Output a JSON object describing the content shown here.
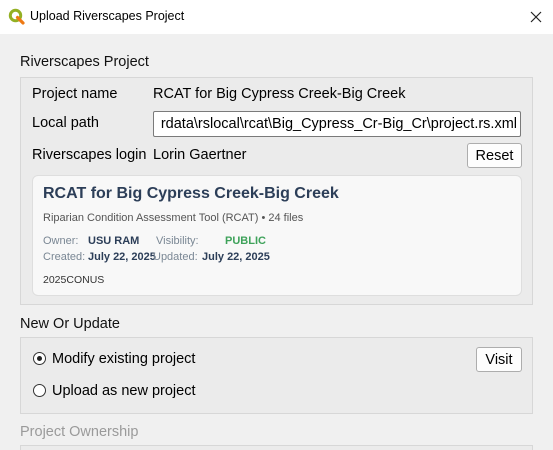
{
  "window": {
    "title": "Upload Riverscapes Project",
    "app_icon": "qgis-icon",
    "close_icon": "close-icon"
  },
  "project_section": {
    "heading": "Riverscapes Project",
    "name_label": "Project name",
    "name_value": "RCAT for Big Cypress Creek-Big Creek",
    "path_label": "Local path",
    "path_value": "rdata\\rslocal\\rcat\\Big_Cypress_Cr-Big_Cr\\project.rs.xml",
    "login_label": "Riverscapes login",
    "login_value": "Lorin Gaertner",
    "reset_label": "Reset"
  },
  "project_card": {
    "title": "RCAT for Big Cypress Creek-Big Creek",
    "subtitle": "Riparian Condition Assessment Tool (RCAT) • 24 files",
    "owner_label": "Owner:",
    "owner_value": "USU RAM",
    "visibility_label": "Visibility:",
    "visibility_value": "PUBLIC",
    "created_label": "Created:",
    "created_value": "July 22, 2025",
    "updated_label": "Updated:",
    "updated_value": "July 22, 2025",
    "tag": "2025CONUS",
    "colors": {
      "title": "#2c3e58",
      "public": "#3ea25a"
    }
  },
  "mode_section": {
    "heading": "New Or Update",
    "options": [
      {
        "label": "Modify existing project",
        "checked": true
      },
      {
        "label": "Upload as new project",
        "checked": false
      }
    ],
    "visit_label": "Visit"
  },
  "ownership_section": {
    "heading": "Project Ownership"
  }
}
